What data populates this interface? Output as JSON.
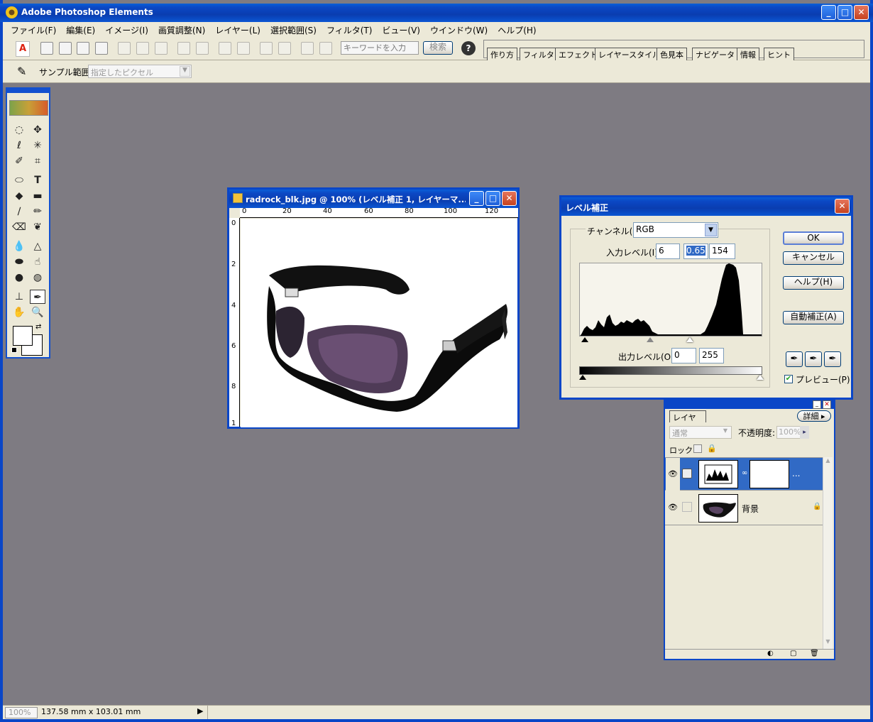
{
  "app": {
    "title": "Adobe Photoshop Elements"
  },
  "menubar": [
    "ファイル(F)",
    "編集(E)",
    "イメージ(I)",
    "画質調整(N)",
    "レイヤー(L)",
    "選択範囲(S)",
    "フィルタ(T)",
    "ビュー(V)",
    "ウインドウ(W)",
    "ヘルプ(H)"
  ],
  "shortcuts": {
    "search_placeholder": "キーワードを入力",
    "search_button": "検索",
    "palette_tabs": [
      "作り方",
      "フィルタ",
      "エフェクト",
      "レイヤースタイル",
      "色見本",
      "ナビゲータ",
      "情報",
      "ヒント"
    ]
  },
  "options": {
    "sample_label": "サンプル範囲:",
    "sample_value": "指定したピクセル"
  },
  "document": {
    "title": "radrock_blk.jpg @ 100% (レベル補正 1, レイヤーマ...",
    "ruler_h": [
      "0",
      "20",
      "40",
      "60",
      "80",
      "100",
      "120"
    ],
    "ruler_v": [
      "0",
      "2",
      "4",
      "6",
      "8",
      "1"
    ]
  },
  "levels": {
    "title": "レベル補正",
    "channel_label": "チャンネル(C):",
    "channel_value": "RGB",
    "input_label": "入力レベル(I):",
    "input_values": [
      "6",
      "0.65",
      "154"
    ],
    "output_label": "出力レベル(O):",
    "output_values": [
      "0",
      "255"
    ],
    "buttons": {
      "ok": "OK",
      "cancel": "キャンセル",
      "help": "ヘルプ(H)",
      "auto": "自動補正(A)"
    },
    "preview_label": "プレビュー(P)",
    "preview_checked": true
  },
  "layers": {
    "tab": "レイヤー",
    "more": "詳細",
    "blend_mode": "通常",
    "opacity_label": "不透明度:",
    "opacity_value": "100%",
    "lock_label": "ロック:",
    "items": [
      {
        "name": "...",
        "selected": true
      },
      {
        "name": "背景",
        "selected": false
      }
    ]
  },
  "status": {
    "zoom": "100%",
    "doc_size": "137.58 mm x 103.01 mm"
  }
}
